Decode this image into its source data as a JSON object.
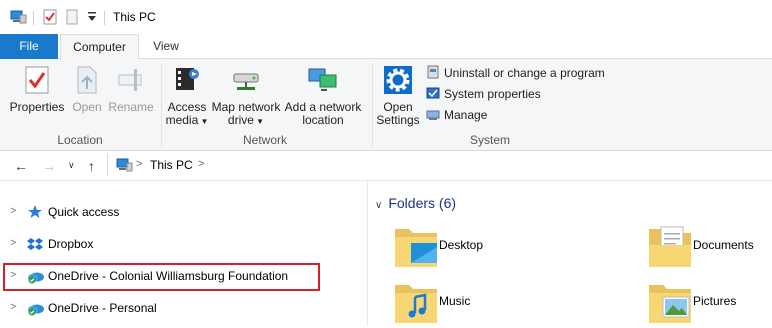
{
  "window": {
    "title": "This PC"
  },
  "tabs": {
    "file": "File",
    "computer": "Computer",
    "view": "View"
  },
  "ribbon": {
    "location": {
      "group_label": "Location",
      "properties": "Properties",
      "open": "Open",
      "rename": "Rename"
    },
    "network": {
      "group_label": "Network",
      "access_media_l1": "Access",
      "access_media_l2": "media",
      "map_drive_l1": "Map network",
      "map_drive_l2": "drive",
      "add_location_l1": "Add a network",
      "add_location_l2": "location"
    },
    "system": {
      "group_label": "System",
      "open_settings_l1": "Open",
      "open_settings_l2": "Settings",
      "uninstall": "Uninstall or change a program",
      "system_properties": "System properties",
      "manage": "Manage"
    }
  },
  "address": {
    "path": "This PC"
  },
  "nav": {
    "items": [
      {
        "label": "Quick access"
      },
      {
        "label": "Dropbox"
      },
      {
        "label": "OneDrive - Colonial Williamsburg Foundation"
      },
      {
        "label": "OneDrive - Personal"
      }
    ]
  },
  "content": {
    "header": "Folders (6)",
    "folders": [
      {
        "label": "Desktop"
      },
      {
        "label": "Documents"
      },
      {
        "label": "Music"
      },
      {
        "label": "Pictures"
      }
    ]
  },
  "colors": {
    "file_tab": "#1979ca",
    "accent": "#1e3287",
    "highlight": "#d8202a"
  }
}
